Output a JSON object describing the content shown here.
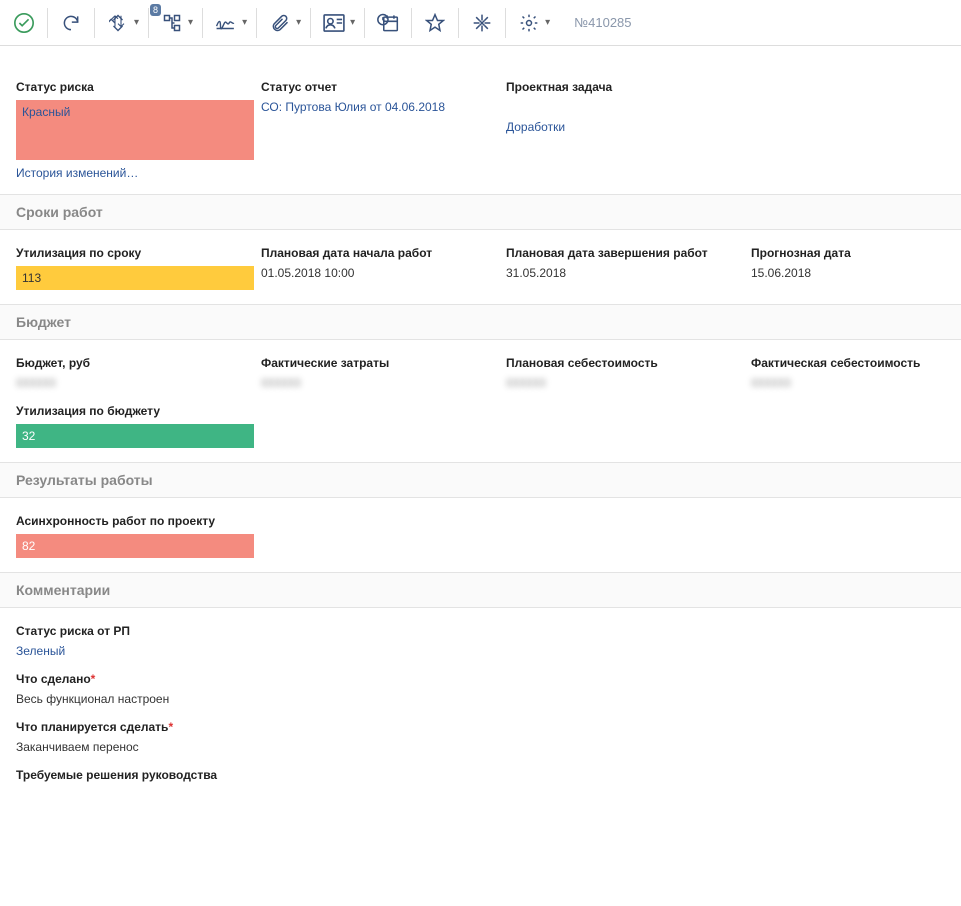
{
  "toolbar": {
    "badge": "8",
    "docnum": "№410285"
  },
  "risk": {
    "status_label": "Статус риска",
    "status_value": "Красный",
    "report_label": "Статус отчет",
    "report_value": "СО: Пуртова Юлия от 04.06.2018",
    "task_label": "Проектная задача",
    "task_value": "Доработки",
    "history_link": "История изменений…"
  },
  "dates": {
    "section": "Сроки работ",
    "util_label": "Утилизация по сроку",
    "util_value": "113",
    "plan_start_label": "Плановая дата начала работ",
    "plan_start_value": "01.05.2018 10:00",
    "plan_end_label": "Плановая дата завершения работ",
    "plan_end_value": "31.05.2018",
    "forecast_label": "Прогнозная дата",
    "forecast_value": "15.06.2018"
  },
  "budget": {
    "section": "Бюджет",
    "rub_label": "Бюджет, руб",
    "rub_value": "000000",
    "fact_label": "Фактические затраты",
    "fact_value": "000000",
    "plan_cost_label": "Плановая себестоимость",
    "plan_cost_value": "000000",
    "fact_cost_label": "Фактическая себестоимость",
    "fact_cost_value": "000000",
    "util_label": "Утилизация по бюджету",
    "util_value": "32"
  },
  "results": {
    "section": "Результаты работы",
    "async_label": "Асинхронность работ по проекту",
    "async_value": "82"
  },
  "comments": {
    "section": "Комментарии",
    "rp_status_label": "Статус риска от РП",
    "rp_status_value": "Зеленый",
    "done_label": "Что сделано",
    "done_value": "Весь функционал настроен",
    "plan_label": "Что планируется сделать",
    "plan_value": "Заканчиваем перенос",
    "decisions_label": "Требуемые решения руководства"
  }
}
